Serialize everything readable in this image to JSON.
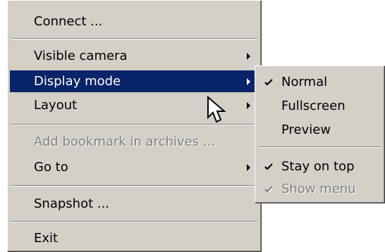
{
  "main_menu": {
    "connect": "Connect ...",
    "visible_camera": "Visible camera",
    "display_mode": "Display mode",
    "layout": "Layout",
    "add_bookmark": "Add bookmark in archives ...",
    "go_to": "Go to",
    "snapshot": "Snapshot ...",
    "exit": "Exit"
  },
  "sub_menu": {
    "normal": "Normal",
    "fullscreen": "Fullscreen",
    "preview": "Preview",
    "stay_on_top": "Stay on top",
    "show_menu": "Show menu"
  },
  "colors": {
    "menu_bg": "#d4d0c8",
    "highlight_bg": "#0a246a",
    "disabled_text": "#808080"
  },
  "icons": {
    "submenu_arrow": "triangle-right",
    "check": "checkmark",
    "cursor": "mouse-pointer"
  }
}
